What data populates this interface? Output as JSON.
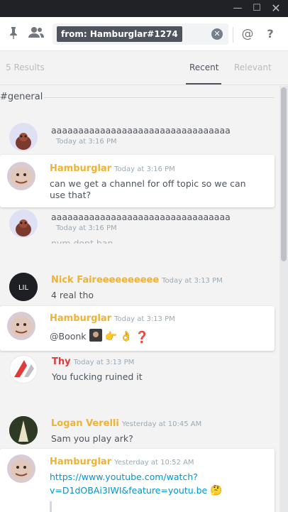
{
  "window": {
    "minimize_glyph": "—",
    "maximize_glyph": "☐",
    "close_glyph": "✕"
  },
  "toolbar": {
    "search_query": "from: Hamburglar#1274",
    "icons": [
      "pin-icon",
      "members-icon",
      "clear-search-icon",
      "at-icon",
      "help-icon"
    ],
    "at_glyph": "@",
    "help_glyph": "?"
  },
  "results": {
    "count_label": "5 Results",
    "tabs": [
      {
        "label": "Recent",
        "active": true
      },
      {
        "label": "Relevant",
        "active": false
      }
    ],
    "channel": "#general"
  },
  "messages": [
    {
      "author": "",
      "timestamp": "Today at 3:16 PM",
      "text": "aaaaaaaaaaaaaaaaaaaaaaaaaaaaaaaaa",
      "hit": false
    },
    {
      "author": "Hamburglar",
      "timestamp": "Today at 3:16 PM",
      "text_line1": "can we get a channel for off topic so we can",
      "text_line2": "use that?",
      "hit": true
    },
    {
      "author": "",
      "timestamp": "Today at 3:16 PM",
      "text": "aaaaaaaaaaaaaaaaaaaaaaaaaaaaaaaaa",
      "next_text": "nvm dont ban",
      "hit": false
    },
    {
      "author": "Nick Faireeeeeeeeee",
      "timestamp": "Today at 3:13 PM",
      "text": "4 real tho",
      "hit": false
    },
    {
      "author": "Hamburglar",
      "timestamp": "Today at 3:13 PM",
      "text": "@Boonk",
      "emojis": [
        "👉",
        "👌",
        "❓"
      ],
      "hit": true
    },
    {
      "author": "Thy",
      "timestamp": "Today at 3:13 PM",
      "text": "You fucking ruined it",
      "hit": false
    },
    {
      "author": "Logan Verelli",
      "timestamp": "Yesterday at 10:45 AM",
      "text": "Sam you play ark?",
      "hit": false
    },
    {
      "author": "Hamburglar",
      "timestamp": "Yesterday at 10:52 AM",
      "link_line1": "https://www.youtube.com/watch?",
      "link_line2": "v=D1dOBAi3IWI&feature=youtu.be",
      "emoji": "🤔",
      "hit": true
    }
  ],
  "colors": {
    "hamburglar": "#f0b232",
    "nick": "#f0b232",
    "thy": "#e03a3a",
    "logan": "#f0b232",
    "link": "#0096cf"
  }
}
